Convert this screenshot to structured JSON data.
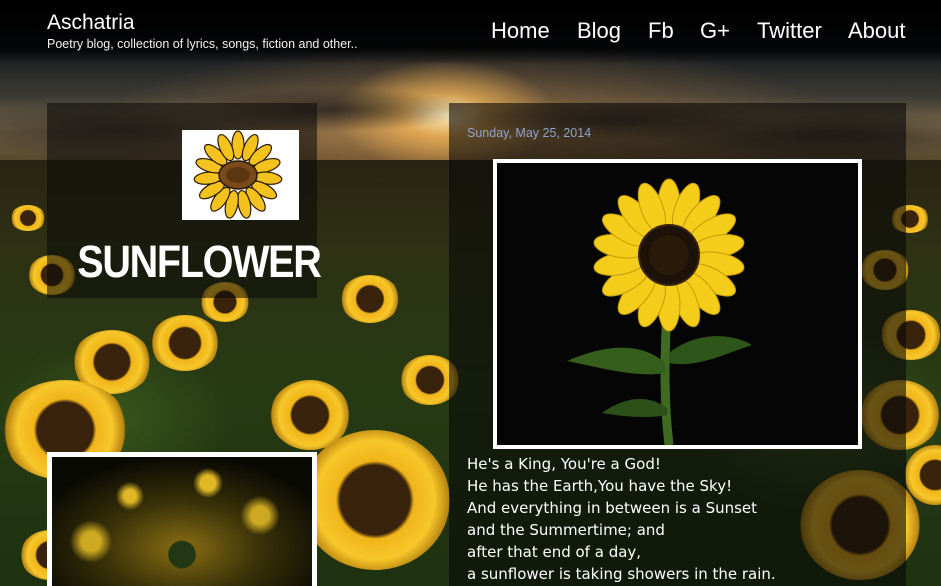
{
  "header": {
    "title": "Aschatria",
    "description": "Poetry blog, collection of lyrics, songs, fiction and other..",
    "nav": [
      {
        "label": "Home"
      },
      {
        "label": "Blog"
      },
      {
        "label": "Fb"
      },
      {
        "label": "G+"
      },
      {
        "label": "Twitter"
      },
      {
        "label": "About"
      }
    ]
  },
  "sidebar": {
    "logo_text": "SUNFLOWER"
  },
  "post": {
    "date": "Sunday, May 25, 2014",
    "lines": [
      "He's a King, You're a God!",
      "He has the Earth,You have the Sky!",
      "And everything in between is a Sunset",
      "and the Summertime; and",
      "after that end of a day,",
      "a sunflower is taking showers in the rain."
    ]
  },
  "colors": {
    "date_text": "#8fa3cf",
    "image_border": "#ffffff",
    "sunflower_petal": "#f7c72a",
    "sunflower_center": "#3a230c"
  }
}
